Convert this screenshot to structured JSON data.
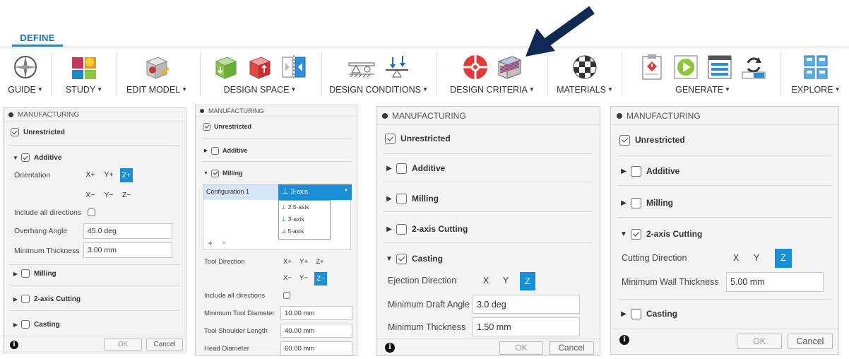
{
  "ribbon": {
    "tab": "DEFINE",
    "groups": [
      {
        "label": "GUIDE",
        "icons": [
          "compass-icon"
        ]
      },
      {
        "label": "STUDY",
        "icons": [
          "study-icon"
        ]
      },
      {
        "label": "EDIT MODEL",
        "icons": [
          "edit-model-icon"
        ]
      },
      {
        "label": "DESIGN SPACE",
        "icons": [
          "preserve-geometry-icon",
          "obstacle-geometry-icon",
          "symmetry-plane-icon"
        ]
      },
      {
        "label": "DESIGN CONDITIONS",
        "icons": [
          "structural-constraint-icon",
          "structural-load-icon"
        ]
      },
      {
        "label": "DESIGN CRITERIA",
        "icons": [
          "objectives-icon",
          "manufacturing-icon"
        ]
      },
      {
        "label": "MATERIALS",
        "icons": [
          "materials-icon"
        ]
      },
      {
        "label": "GENERATE",
        "icons": [
          "pre-check-icon",
          "preview-icon",
          "generate-icon",
          "sync-icon"
        ]
      },
      {
        "label": "EXPLORE",
        "icons": [
          "explore-icon"
        ]
      }
    ],
    "colors": {
      "accent": "#1a8fd8",
      "arrow": "#0e2a52"
    }
  },
  "dialogs": {
    "title": "MANUFACTURING",
    "unrestricted": "Unrestricted",
    "additive": "Additive",
    "milling": "Milling",
    "cutting": "2-axis Cutting",
    "casting": "Casting",
    "ok": "OK",
    "cancel": "Cancel",
    "info": "i",
    "d1": {
      "orientation": "Orientation",
      "axes_pos": [
        "X+",
        "Y+",
        "Z+"
      ],
      "axes_neg": [
        "X−",
        "Y−",
        "Z−"
      ],
      "include_all": "Include all directions",
      "overhang_label": "Overhang Angle",
      "overhang_value": "45.0 deg",
      "min_thick_label": "Minimum Thickness",
      "min_thick_value": "3.00 mm"
    },
    "d2": {
      "config_name": "Configuration 1",
      "config_value": "3-axis",
      "config_options": [
        "2.5-axis",
        "3-axis",
        "5-axis"
      ],
      "add": "+",
      "remove": "×",
      "tool_direction": "Tool Direction",
      "axes_pos": [
        "X+",
        "Y+",
        "Z+"
      ],
      "axes_neg": [
        "X−",
        "Y−",
        "Z−"
      ],
      "include_all": "Include all directions",
      "min_tool_label": "Minimum Tool Diameter",
      "min_tool_value": "10.00 mm",
      "shoulder_label": "Tool Shoulder Length",
      "shoulder_value": "40.00 mm",
      "head_label": "Head Diameter",
      "head_value": "60.00 mm"
    },
    "d3": {
      "ejection": "Ejection Direction",
      "axes": [
        "X",
        "Y",
        "Z"
      ],
      "draft_label": "Minimum Draft Angle",
      "draft_value": "3.0 deg",
      "min_thick_label": "Minimum Thickness",
      "min_thick_value": "1.50 mm"
    },
    "d4": {
      "cutting_dir": "Cutting Direction",
      "axes": [
        "X",
        "Y",
        "Z"
      ],
      "min_wall_label": "Minimum Wall Thickness",
      "min_wall_value": "5.00 mm"
    }
  }
}
